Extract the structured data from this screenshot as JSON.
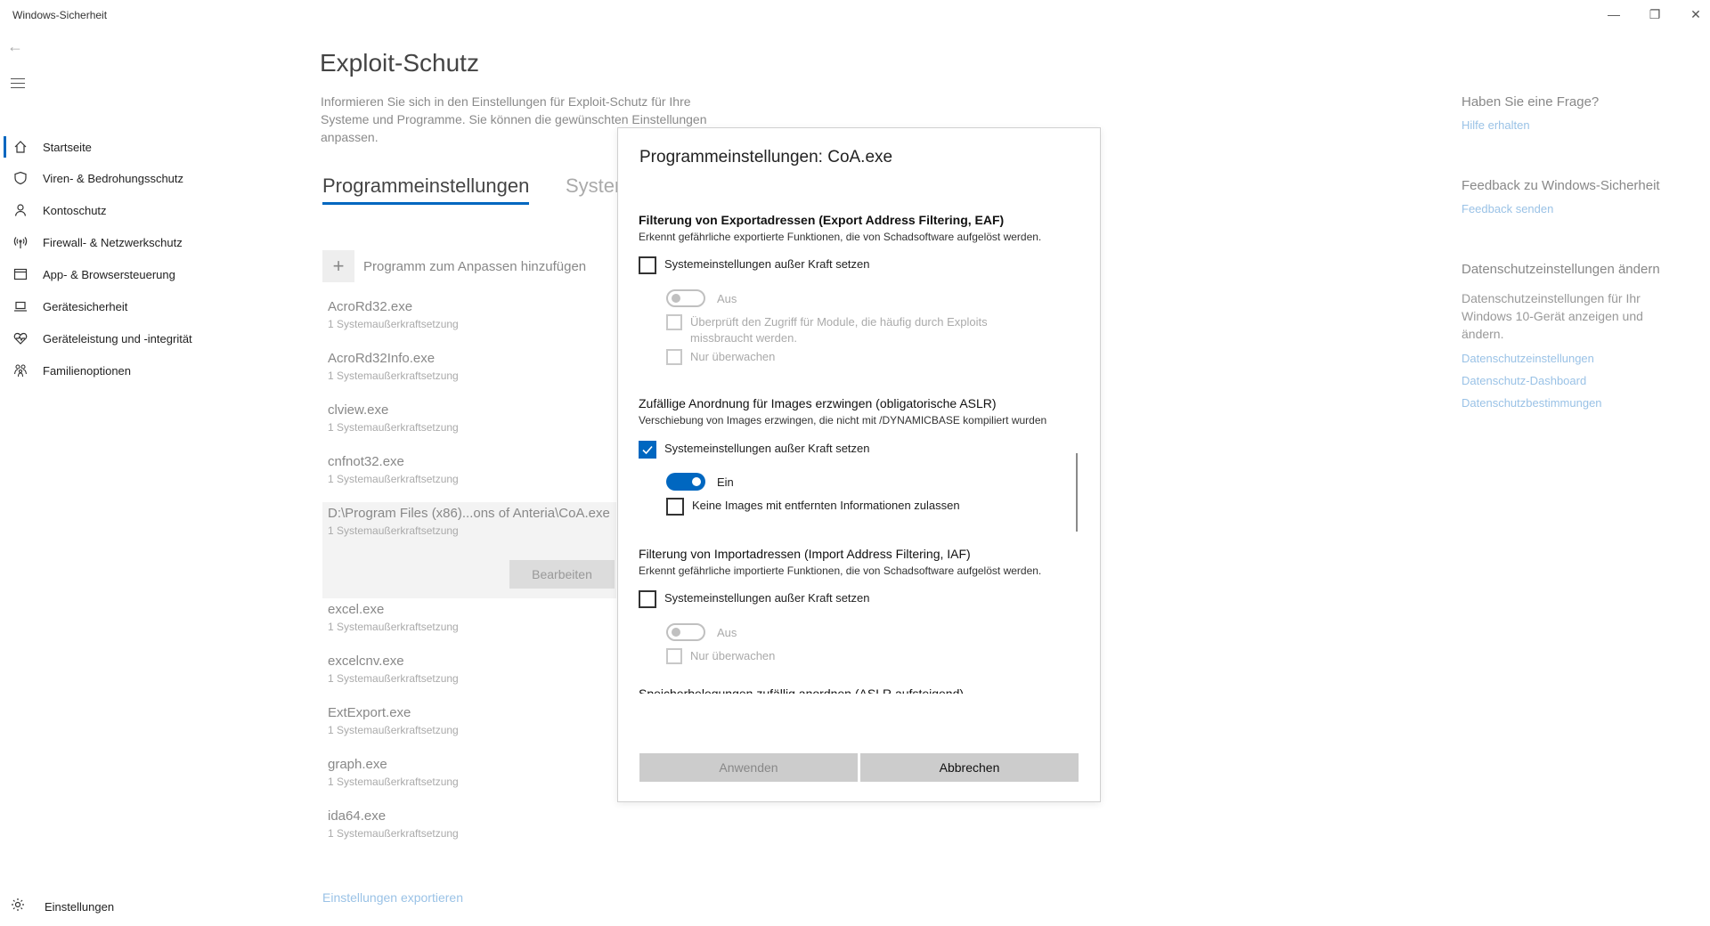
{
  "window": {
    "title": "Windows-Sicherheit",
    "controls": {
      "minimize": "—",
      "maximize": "❐",
      "close": "✕"
    }
  },
  "sidebar": {
    "back_icon": "←",
    "items": [
      {
        "label": "Startseite",
        "icon": "home-icon",
        "active": true
      },
      {
        "label": "Viren- & Bedrohungsschutz",
        "icon": "shield-icon"
      },
      {
        "label": "Kontoschutz",
        "icon": "person-icon"
      },
      {
        "label": "Firewall- & Netzwerkschutz",
        "icon": "antenna-icon"
      },
      {
        "label": "App- & Browsersteuerung",
        "icon": "app-window-icon"
      },
      {
        "label": "Gerätesicherheit",
        "icon": "laptop-icon"
      },
      {
        "label": "Geräteleistung und -integrität",
        "icon": "heart-pulse-icon"
      },
      {
        "label": "Familienoptionen",
        "icon": "family-icon"
      }
    ],
    "settings_label": "Einstellungen"
  },
  "main": {
    "title": "Exploit-Schutz",
    "description": "Informieren Sie sich in den Einstellungen für Exploit-Schutz für Ihre Systeme und Programme. Sie können die gewünschten Einstellungen anpassen.",
    "tabs": [
      {
        "label": "Programmeinstellungen",
        "active": true
      },
      {
        "label": "Systemeinstellungen",
        "active": false
      }
    ],
    "add_program_label": "Programm zum Anpassen hinzufügen",
    "programs": [
      {
        "name": "AcroRd32.exe",
        "sub": "1 Systemaußerkraftsetzung"
      },
      {
        "name": "AcroRd32Info.exe",
        "sub": "1 Systemaußerkraftsetzung"
      },
      {
        "name": "clview.exe",
        "sub": "1 Systemaußerkraftsetzung"
      },
      {
        "name": "cnfnot32.exe",
        "sub": "1 Systemaußerkraftsetzung"
      },
      {
        "name": "D:\\Program Files (x86)...ons of Anteria\\CoA.exe",
        "sub": "1 Systemaußerkraftsetzung",
        "selected": true,
        "edit_label": "Bearbeiten"
      },
      {
        "name": "excel.exe",
        "sub": "1 Systemaußerkraftsetzung"
      },
      {
        "name": "excelcnv.exe",
        "sub": "1 Systemaußerkraftsetzung"
      },
      {
        "name": "ExtExport.exe",
        "sub": "1 Systemaußerkraftsetzung"
      },
      {
        "name": "graph.exe",
        "sub": "1 Systemaußerkraftsetzung"
      },
      {
        "name": "ida64.exe",
        "sub": "1 Systemaußerkraftsetzung"
      }
    ],
    "export_link": "Einstellungen exportieren"
  },
  "right": {
    "question_heading": "Haben Sie eine Frage?",
    "help_link": "Hilfe erhalten",
    "feedback_heading": "Feedback zu Windows-Sicherheit",
    "feedback_link": "Feedback senden",
    "privacy_heading": "Datenschutzeinstellungen ändern",
    "privacy_text": "Datenschutzeinstellungen für Ihr Windows 10-Gerät anzeigen und ändern.",
    "privacy_links": [
      "Datenschutzeinstellungen",
      "Datenschutz-Dashboard",
      "Datenschutzbestimmungen"
    ]
  },
  "dialog": {
    "title": "Programmeinstellungen: CoA.exe",
    "sections": {
      "eaf": {
        "title": "Filterung von Exportadressen (Export Address Filtering, EAF)",
        "desc": "Erkennt gefährliche exportierte Funktionen, die von Schadsoftware aufgelöst werden.",
        "override_label": "Systemeinstellungen außer Kraft setzen",
        "override_checked": false,
        "toggle_label": "Aus",
        "toggle_on": false,
        "option1": "Überprüft den Zugriff für Module, die häufig durch Exploits missbraucht werden.",
        "option2": "Nur überwachen"
      },
      "aslr": {
        "title": "Zufällige Anordnung für Images erzwingen (obligatorische ASLR)",
        "desc": "Verschiebung von Images erzwingen, die nicht mit /DYNAMICBASE kompiliert wurden",
        "override_label": "Systemeinstellungen außer Kraft setzen",
        "override_checked": true,
        "toggle_label": "Ein",
        "toggle_on": true,
        "option1": "Keine Images mit entfernten Informationen zulassen"
      },
      "iaf": {
        "title": "Filterung von Importadressen (Import Address Filtering, IAF)",
        "desc": "Erkennt gefährliche importierte Funktionen, die von Schadsoftware aufgelöst werden.",
        "override_label": "Systemeinstellungen außer Kraft setzen",
        "override_checked": false,
        "toggle_label": "Aus",
        "toggle_on": false,
        "option1": "Nur überwachen"
      },
      "aslr_bottomup": {
        "title": "Speicherbelegungen zufällig anordnen (ASLR aufsteigend)"
      }
    },
    "apply_label": "Anwenden",
    "cancel_label": "Abbrechen"
  },
  "colors": {
    "accent": "#0067c0",
    "link": "#9ac2e6"
  }
}
